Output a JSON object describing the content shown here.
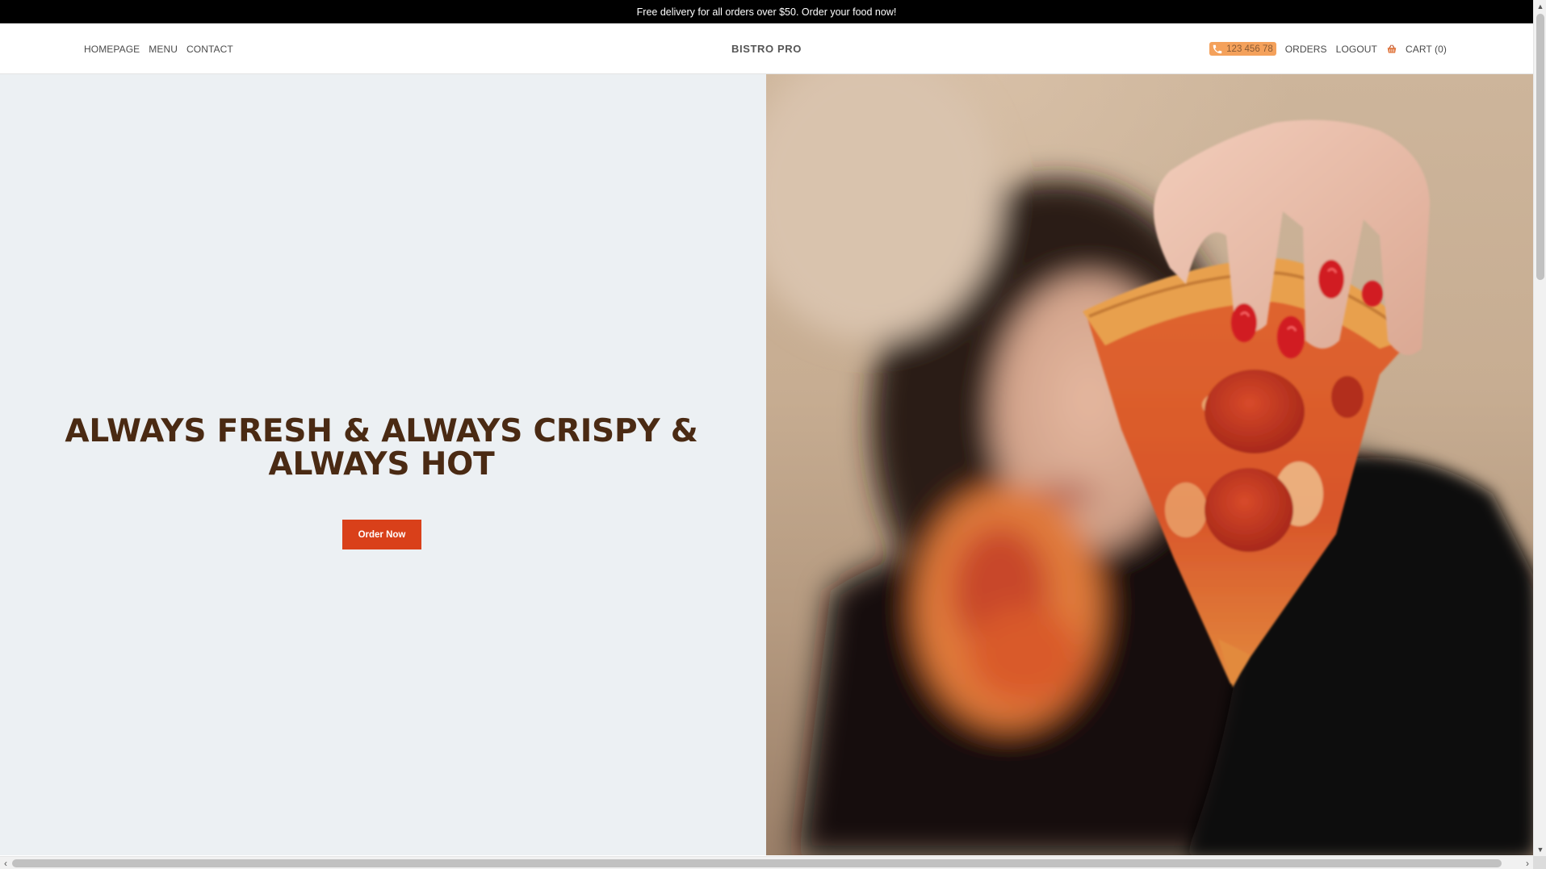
{
  "announcement": {
    "text": "Free delivery for all orders over $50. Order your food now!"
  },
  "header": {
    "nav_left": [
      {
        "label": "HOMEPAGE"
      },
      {
        "label": "MENU"
      },
      {
        "label": "CONTACT"
      }
    ],
    "brand": "BISTRO PRO",
    "phone": "123 456 78",
    "orders_label": "ORDERS",
    "logout_label": "LOGOUT",
    "cart_label": "CART (0)"
  },
  "hero": {
    "title": "ALWAYS FRESH & ALWAYS CRISPY & ALWAYS HOT",
    "button_label": "Order Now"
  },
  "colors": {
    "announcement_bg": "#000000",
    "phone_pill": "#f4a15b",
    "hero_left_bg": "#ecf0f3",
    "title_color": "#4a2a13",
    "button_bg": "#d9401a"
  },
  "icons": {
    "phone": "phone-icon",
    "cart": "shopping-basket-icon"
  }
}
